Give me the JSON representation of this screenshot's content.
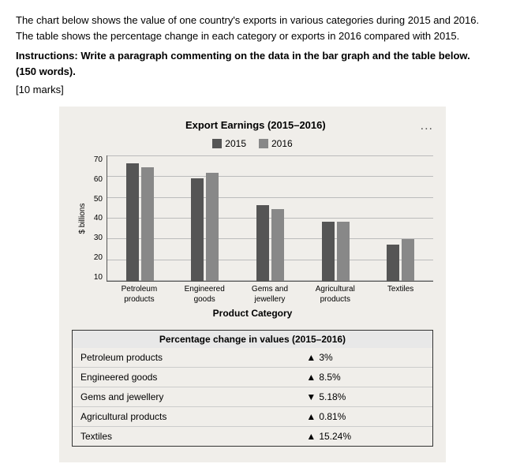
{
  "intro": {
    "para1": "The chart below shows the value of one country's exports in various categories during 2015 and 2016. The table shows the percentage change in each category or exports in 2016 compared with 2015.",
    "instruction": "Instructions: Write a paragraph commenting on the data in the bar graph and the table below. (150 words).",
    "marks": "[10 marks]"
  },
  "chart": {
    "title": "Export Earnings (2015–2016)",
    "menu": "...",
    "legend": [
      {
        "label": "2015",
        "color": "#555555"
      },
      {
        "label": "2016",
        "color": "#888888"
      }
    ],
    "yAxisLabel": "$ billions",
    "yTicks": [
      "70",
      "60",
      "50",
      "40",
      "30",
      "20",
      "10"
    ],
    "xAxisTitle": "Product Category",
    "categories": [
      {
        "label": "Petroleum\nproducts",
        "val2015": 65,
        "val2016": 63,
        "max": 70
      },
      {
        "label": "Engineered\ngoods",
        "val2015": 57,
        "val2016": 60,
        "max": 70
      },
      {
        "label": "Gems and\njewellery",
        "val2015": 42,
        "val2016": 40,
        "max": 70
      },
      {
        "label": "Agricultural\nproducts",
        "val2015": 33,
        "val2016": 33,
        "max": 70
      },
      {
        "label": "Textiles",
        "val2015": 20,
        "val2016": 23,
        "max": 70
      }
    ]
  },
  "table": {
    "header": "Percentage change in values (2015–2016)",
    "rows": [
      {
        "category": "Petroleum products",
        "arrow": "up",
        "value": "3%"
      },
      {
        "category": "Engineered goods",
        "arrow": "up",
        "value": "8.5%"
      },
      {
        "category": "Gems and jewellery",
        "arrow": "down",
        "value": "5.18%"
      },
      {
        "category": "Agricultural products",
        "arrow": "up",
        "value": "0.81%"
      },
      {
        "category": "Textiles",
        "arrow": "up",
        "value": "15.24%"
      }
    ]
  }
}
